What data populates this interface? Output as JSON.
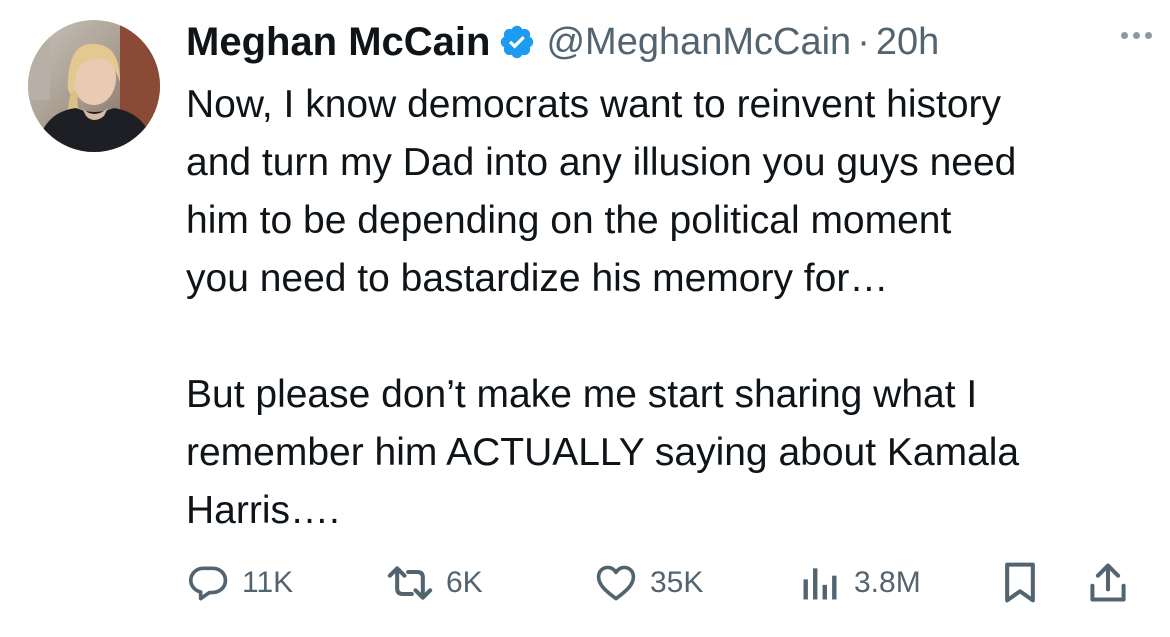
{
  "tweet": {
    "display_name": "Meghan McCain",
    "handle": "@MeghanMcCain",
    "separator": "·",
    "time": "20h",
    "verified_icon": "verified-badge-icon",
    "more_icon": "more-options-icon",
    "body_paragraph_1": "Now, I know democrats want to reinvent history and turn my Dad into any illusion you guys need him to be depending on the political moment you need to bastardize his memory for…",
    "body_paragraph_2": "But please don’t make me start sharing what I remember him ACTUALLY saying about Kamala Harris….",
    "line_1": "Now, I know democrats want to reinvent history",
    "line_2": "and turn my Dad into any illusion you guys need",
    "line_3": "him to be depending on the political moment",
    "line_4": "you need to bastardize his memory for…",
    "line_5": "But please don’t make me start sharing what I",
    "line_6": "remember him ACTUALLY saying about Kamala",
    "line_7": "Harris…."
  },
  "actions": {
    "replies": {
      "icon": "reply-icon",
      "count": "11K"
    },
    "reposts": {
      "icon": "repost-icon",
      "count": "6K"
    },
    "likes": {
      "icon": "heart-icon",
      "count": "35K"
    },
    "views": {
      "icon": "views-chart-icon",
      "count": "3.8M"
    },
    "bookmark": {
      "icon": "bookmark-icon"
    },
    "share": {
      "icon": "share-icon"
    }
  },
  "colors": {
    "text_primary": "#0f1419",
    "text_secondary": "#536471",
    "verified_blue": "#1d9bf0",
    "background": "#ffffff"
  }
}
